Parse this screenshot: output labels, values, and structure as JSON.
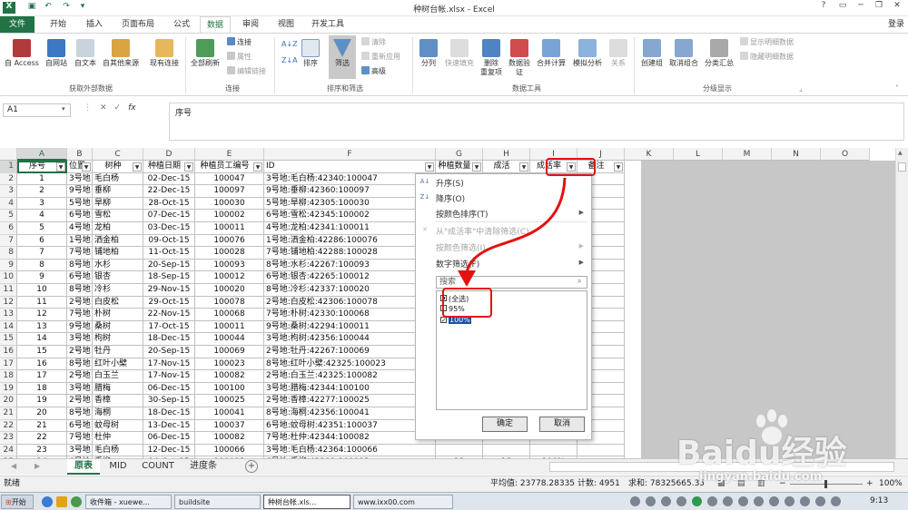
{
  "window": {
    "title": "种树台帐.xlsx - Excel",
    "login": "登录"
  },
  "tabs": [
    "文件",
    "开始",
    "插入",
    "页面布局",
    "公式",
    "数据",
    "审阅",
    "视图",
    "开发工具"
  ],
  "active_tab_index": 5,
  "ribbon": {
    "get_external": [
      {
        "label": "自 Access"
      },
      {
        "label": "自网站"
      },
      {
        "label": "自文本"
      },
      {
        "label": "自其他来源"
      },
      {
        "label": "现有连接"
      }
    ],
    "get_external_group": "获取外部数据",
    "refresh_all": "全部刷新",
    "connections_small": [
      "连接",
      "属性",
      "编辑链接"
    ],
    "connections_group": "连接",
    "sort_asc_icon": "A↓Z",
    "sort_desc_icon": "Z↓A",
    "sort": "排序",
    "filter": "筛选",
    "filter_small": [
      "清除",
      "重新应用",
      "高级"
    ],
    "sort_filter_group": "排序和筛选",
    "data_tools": [
      "分列",
      "快速填充",
      "删除\n重复项",
      "数据验\n证",
      "合并计算",
      "模拟分析",
      "关系"
    ],
    "data_tools_group": "数据工具",
    "outline": [
      "创建组",
      "取消组合",
      "分类汇总"
    ],
    "outline_small": [
      "显示明细数据",
      "隐藏明细数据"
    ],
    "outline_group": "分级显示"
  },
  "formula_bar": {
    "name_box": "A1",
    "fx": "fx",
    "formula": "序号"
  },
  "columns": [
    "A",
    "B",
    "C",
    "D",
    "E",
    "F",
    "G",
    "H",
    "I",
    "J",
    "K",
    "L",
    "M",
    "N",
    "O"
  ],
  "header_row": [
    "序号",
    "位置",
    "树种",
    "种植日期",
    "种植员工编号",
    "ID",
    "种植数量",
    "成活",
    "成活率",
    "备注"
  ],
  "rows": [
    [
      "1",
      "3号地",
      "毛白杨",
      "02-Dec-15",
      "100047",
      "3号地:毛白杨:42340:100047"
    ],
    [
      "2",
      "9号地",
      "垂柳",
      "22-Dec-15",
      "100097",
      "9号地:垂柳:42360:100097"
    ],
    [
      "3",
      "5号地",
      "旱柳",
      "28-Oct-15",
      "100030",
      "5号地:旱柳:42305:100030"
    ],
    [
      "4",
      "6号地",
      "雪松",
      "07-Dec-15",
      "100002",
      "6号地:雪松:42345:100002"
    ],
    [
      "5",
      "4号地",
      "龙柏",
      "03-Dec-15",
      "100011",
      "4号地:龙柏:42341:100011"
    ],
    [
      "6",
      "1号地",
      "洒金柏",
      "09-Oct-15",
      "100076",
      "1号地:洒金柏:42286:100076"
    ],
    [
      "7",
      "7号地",
      "铺地柏",
      "11-Oct-15",
      "100028",
      "7号地:铺地柏:42288:100028"
    ],
    [
      "8",
      "8号地",
      "水杉",
      "20-Sep-15",
      "100093",
      "8号地:水杉:42267:100093"
    ],
    [
      "9",
      "6号地",
      "银杏",
      "18-Sep-15",
      "100012",
      "6号地:银杏:42265:100012"
    ],
    [
      "10",
      "8号地",
      "冷杉",
      "29-Nov-15",
      "100020",
      "8号地:冷杉:42337:100020"
    ],
    [
      "11",
      "2号地",
      "白皮松",
      "29-Oct-15",
      "100078",
      "2号地:白皮松:42306:100078"
    ],
    [
      "12",
      "7号地",
      "朴树",
      "22-Nov-15",
      "100068",
      "7号地:朴树:42330:100068"
    ],
    [
      "13",
      "9号地",
      "桑树",
      "17-Oct-15",
      "100011",
      "9号地:桑树:42294:100011"
    ],
    [
      "14",
      "3号地",
      "枸树",
      "18-Dec-15",
      "100044",
      "3号地:枸树:42356:100044"
    ],
    [
      "15",
      "2号地",
      "牡丹",
      "20-Sep-15",
      "100069",
      "2号地:牡丹:42267:100069"
    ],
    [
      "16",
      "8号地",
      "红叶小檗",
      "17-Nov-15",
      "100023",
      "8号地:红叶小檗:42325:100023"
    ],
    [
      "17",
      "2号地",
      "白玉兰",
      "17-Nov-15",
      "100082",
      "2号地:白玉兰:42325:100082"
    ],
    [
      "18",
      "3号地",
      "腊梅",
      "06-Dec-15",
      "100100",
      "3号地:腊梅:42344:100100"
    ],
    [
      "19",
      "2号地",
      "香樟",
      "30-Sep-15",
      "100025",
      "2号地:香樟:42277:100025"
    ],
    [
      "20",
      "8号地",
      "海桐",
      "18-Dec-15",
      "100041",
      "8号地:海桐:42356:100041"
    ],
    [
      "21",
      "6号地",
      "蚊母树",
      "13-Dec-15",
      "100037",
      "6号地:蚊母树:42351:100037"
    ],
    [
      "22",
      "7号地",
      "杜仲",
      "06-Dec-15",
      "100082",
      "7号地:杜仲:42344:100082"
    ],
    [
      "23",
      "3号地",
      "毛白杨",
      "12-Dec-15",
      "100066",
      "3号地:毛白杨:42364:100066"
    ],
    [
      "24",
      "6号地",
      "垂柳",
      "14-Oct-15",
      "100013",
      "6号地:垂柳:42291:100013"
    ]
  ],
  "rows_ghi": {
    "23": [
      "18",
      "18",
      "100%"
    ],
    "24": [
      "17",
      "17",
      "100%"
    ]
  },
  "filter_menu": {
    "sort_asc": "升序(S)",
    "sort_desc": "降序(O)",
    "sort_by_color": "按颜色排序(T)",
    "clear_filter": "从\"成活率\"中清除筛选(C)",
    "filter_by_color": "按颜色筛选(I)",
    "number_filter": "数字筛选(F)",
    "search_placeholder": "搜索",
    "options": [
      {
        "label": "(全选)",
        "state": "partial"
      },
      {
        "label": "95%",
        "state": "off"
      },
      {
        "label": "100%",
        "state": "on"
      }
    ],
    "ok": "确定",
    "cancel": "取消"
  },
  "sheets": [
    "原表",
    "MID",
    "COUNT",
    "进度条"
  ],
  "active_sheet_index": 0,
  "status": {
    "ready": "就绪",
    "average": "平均值: 23778.28335",
    "count": "计数: 4951",
    "sum": "求和: 78325665.35",
    "zoom": "100%"
  },
  "taskbar": {
    "start": "开始",
    "items": [
      "收件箱 - xuewe...",
      "buildsite",
      "种树台帐.xls...",
      "www.ixx00.com"
    ],
    "active_index": 2,
    "clock": "9:13"
  },
  "watermark": {
    "logo": "Baidu经验",
    "url": "jingyan.baidu.com"
  },
  "colors": {
    "excel_green": "#217346",
    "highlight_red": "#e51010"
  }
}
